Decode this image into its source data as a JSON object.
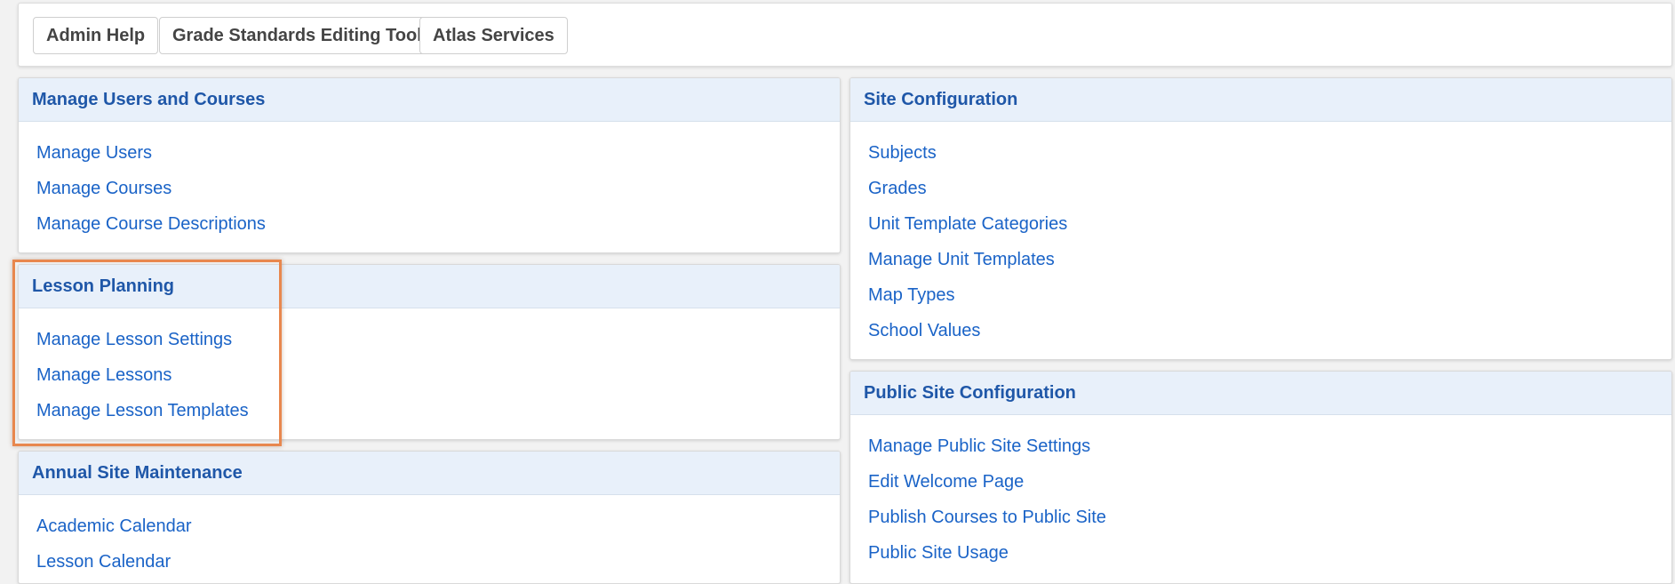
{
  "top_buttons": {
    "admin_help": "Admin Help",
    "grade_standards_editing_tool": "Grade Standards Editing Tool",
    "atlas_services": "Atlas Services"
  },
  "panels": {
    "manage_users_and_courses": {
      "title": "Manage Users and Courses",
      "links": [
        "Manage Users",
        "Manage Courses",
        "Manage Course Descriptions"
      ]
    },
    "lesson_planning": {
      "title": "Lesson Planning",
      "links": [
        "Manage Lesson Settings",
        "Manage Lessons",
        "Manage Lesson Templates"
      ]
    },
    "annual_site_maintenance": {
      "title": "Annual Site Maintenance",
      "links": [
        "Academic Calendar",
        "Lesson Calendar"
      ]
    },
    "site_configuration": {
      "title": "Site Configuration",
      "links": [
        "Subjects",
        "Grades",
        "Unit Template Categories",
        "Manage Unit Templates",
        "Map Types",
        "School Values"
      ]
    },
    "public_site_configuration": {
      "title": "Public Site Configuration",
      "links": [
        "Manage Public Site Settings",
        "Edit Welcome Page",
        "Publish Courses to Public Site",
        "Public Site Usage"
      ]
    }
  },
  "colors": {
    "link": "#1a63c7",
    "heading_text": "#1f57a8",
    "heading_bg": "#e8f0fa",
    "highlight_border": "#e8874e"
  }
}
